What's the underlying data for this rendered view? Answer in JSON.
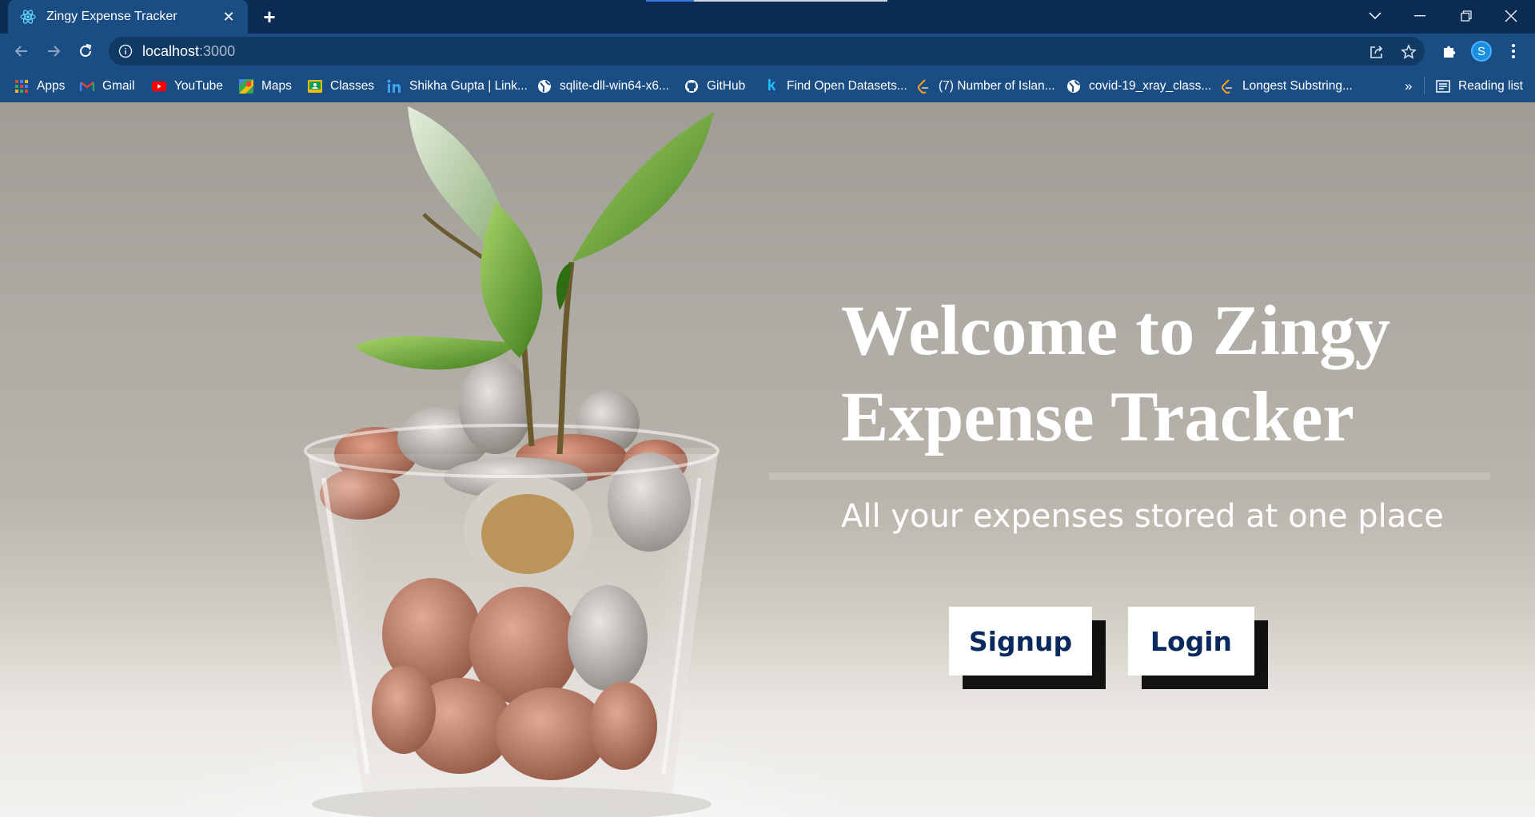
{
  "browser": {
    "tab": {
      "title": "Zingy Expense Tracker",
      "favicon": "react-icon",
      "close": "✕"
    },
    "new_tab": "+",
    "address": {
      "host": "localhost",
      "port": ":3000"
    },
    "avatar_letter": "S",
    "bookmarks": [
      {
        "label": "Apps",
        "icon": "apps-grid-icon"
      },
      {
        "label": "Gmail",
        "icon": "gmail-icon"
      },
      {
        "label": "YouTube",
        "icon": "youtube-icon"
      },
      {
        "label": "Maps",
        "icon": "maps-icon"
      },
      {
        "label": "Classes",
        "icon": "classroom-icon"
      },
      {
        "label": "Shikha Gupta | Link...",
        "icon": "linkedin-icon"
      },
      {
        "label": "sqlite-dll-win64-x6...",
        "icon": "globe-icon"
      },
      {
        "label": "GitHub",
        "icon": "github-icon"
      },
      {
        "label": "Find Open Datasets...",
        "icon": "kaggle-icon"
      },
      {
        "label": "(7) Number of Islan...",
        "icon": "leetcode-icon"
      },
      {
        "label": "covid-19_xray_class...",
        "icon": "globe-icon"
      },
      {
        "label": "Longest Substring...",
        "icon": "leetcode-icon"
      }
    ],
    "overflow": "»",
    "reading_list": "Reading list"
  },
  "hero": {
    "headline_line1": "Welcome to Zingy",
    "headline_line2": "Expense Tracker",
    "subtitle": "All your expenses stored at one place",
    "signup_label": "Signup",
    "login_label": "Login"
  },
  "colors": {
    "chrome_dark": "#0b2b52",
    "chrome": "#1a4d84",
    "button_text": "#0a2a5e"
  }
}
